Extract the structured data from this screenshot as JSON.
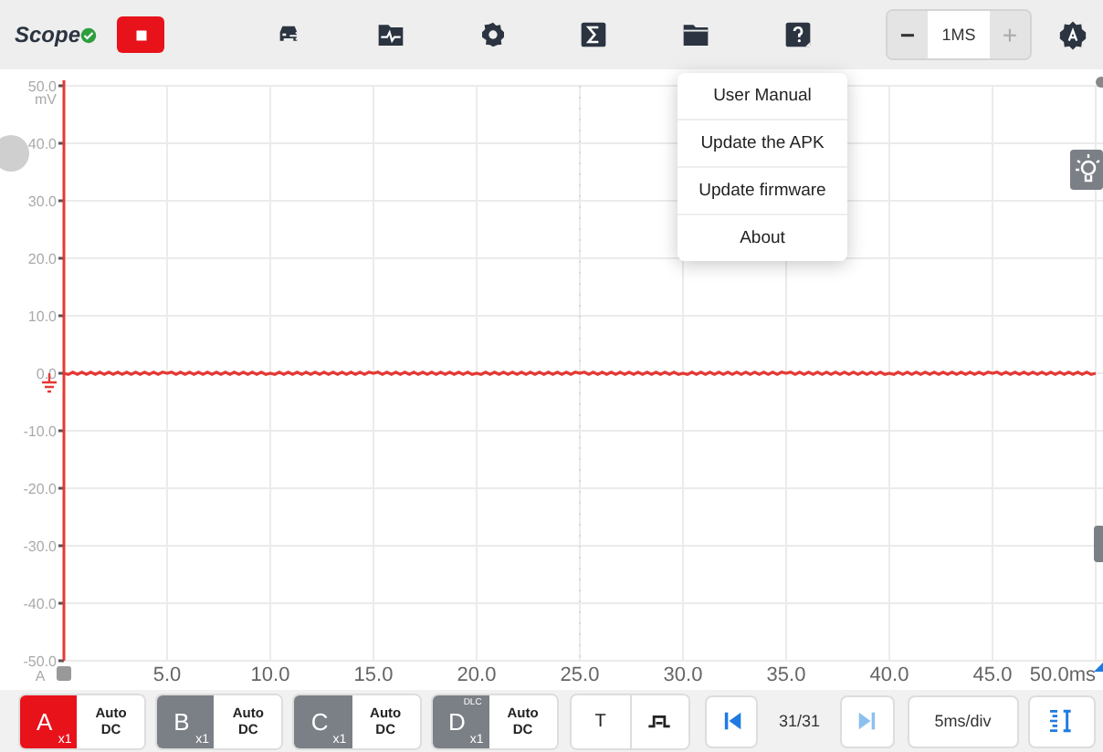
{
  "app": {
    "title": "Scope",
    "connected": true
  },
  "toolbar": {
    "recording": true,
    "timebase": {
      "decrease": "−",
      "value": "1MS",
      "increase": "+"
    }
  },
  "help_menu": {
    "open": true,
    "items": [
      "User Manual",
      "Update the APK",
      "Update firmware",
      "About"
    ]
  },
  "chart": {
    "chart_data": {
      "type": "line",
      "ylabel": "mV",
      "grid": true,
      "x": [
        0,
        5,
        10,
        15,
        20,
        25,
        30,
        35,
        40,
        45,
        50
      ],
      "series": [
        {
          "name": "A",
          "color": "#e53935",
          "values": [
            0,
            0,
            0,
            0,
            0,
            0,
            0,
            0,
            0,
            0,
            0
          ]
        }
      ],
      "xlim": [
        0,
        50
      ],
      "ylim": [
        -50,
        50
      ],
      "ref_lines": [
        {
          "axis": "x",
          "value": 25
        }
      ],
      "xticks": [
        {
          "value": 5,
          "label": "5.0"
        },
        {
          "value": 10,
          "label": "10.0"
        },
        {
          "value": 15,
          "label": "15.0"
        },
        {
          "value": 20,
          "label": "20.0"
        },
        {
          "value": 25,
          "label": "25.0"
        },
        {
          "value": 30,
          "label": "30.0"
        },
        {
          "value": 35,
          "label": "35.0"
        },
        {
          "value": 40,
          "label": "40.0"
        },
        {
          "value": 45,
          "label": "45.0"
        },
        {
          "value": 50,
          "label": "50.0ms"
        }
      ],
      "yticks": [
        {
          "value": 50,
          "label": "50.0"
        },
        {
          "value": 40,
          "label": "40.0"
        },
        {
          "value": 30,
          "label": "30.0"
        },
        {
          "value": 20,
          "label": "20.0"
        },
        {
          "value": 10,
          "label": "10.0"
        },
        {
          "value": 0,
          "label": "0.0"
        },
        {
          "value": -10,
          "label": "-10.0"
        },
        {
          "value": -20,
          "label": "-20.0"
        },
        {
          "value": -30,
          "label": "-30.0"
        },
        {
          "value": -40,
          "label": "-40.0"
        },
        {
          "value": -50,
          "label": "-50.0"
        }
      ]
    }
  },
  "channels": [
    {
      "label": "A",
      "probe": "x1",
      "mode": "Auto",
      "coupling": "DC",
      "active": true
    },
    {
      "label": "B",
      "probe": "x1",
      "mode": "Auto",
      "coupling": "DC",
      "active": false
    },
    {
      "label": "C",
      "probe": "x1",
      "mode": "Auto",
      "coupling": "DC",
      "active": false
    },
    {
      "label": "D",
      "probe": "x1",
      "tag": "DLC",
      "mode": "Auto",
      "coupling": "DC",
      "active": false
    }
  ],
  "trigger": {
    "label": "T"
  },
  "navigation": {
    "counter": "31/31",
    "next_disabled": true
  },
  "time_per_div": "5ms/div"
}
